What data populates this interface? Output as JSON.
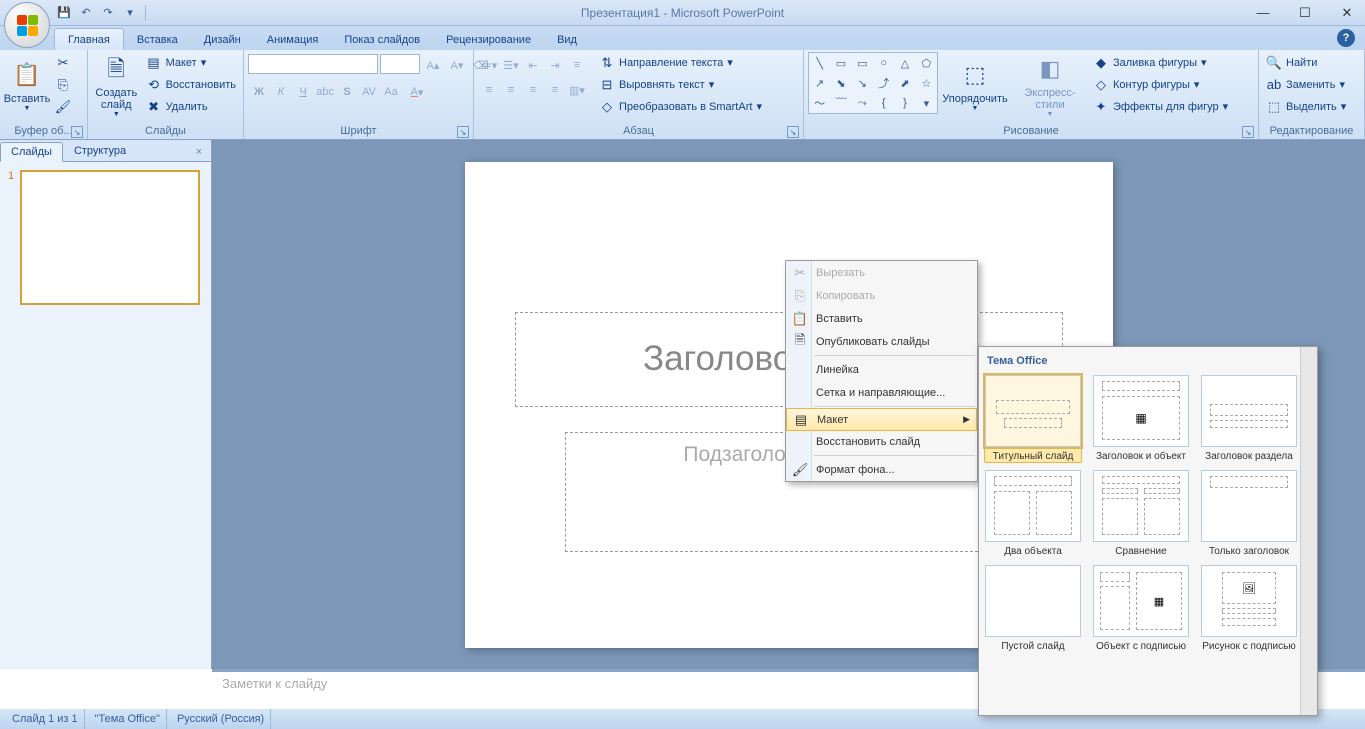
{
  "title": "Презентация1 - Microsoft PowerPoint",
  "tabs": {
    "home": "Главная",
    "insert": "Вставка",
    "design": "Дизайн",
    "animation": "Анимация",
    "slideshow": "Показ слайдов",
    "review": "Рецензирование",
    "view": "Вид"
  },
  "ribbon": {
    "clipboard": {
      "label": "Буфер об...",
      "paste": "Вставить"
    },
    "slides": {
      "label": "Слайды",
      "new": "Создать слайд",
      "layout": "Макет",
      "reset": "Восстановить",
      "delete": "Удалить"
    },
    "font": {
      "label": "Шрифт"
    },
    "paragraph": {
      "label": "Абзац",
      "textdir": "Направление текста",
      "align": "Выровнять текст",
      "smartart": "Преобразовать в SmartArt"
    },
    "drawing": {
      "label": "Рисование",
      "arrange": "Упорядочить",
      "quick": "Экспресс-стили",
      "fill": "Заливка фигуры",
      "outline": "Контур фигуры",
      "effects": "Эффекты для фигур"
    },
    "editing": {
      "label": "Редактирование",
      "find": "Найти",
      "replace": "Заменить",
      "select": "Выделить"
    }
  },
  "outline": {
    "slides": "Слайды",
    "structure": "Структура",
    "num": "1"
  },
  "slide": {
    "title": "Заголовок слайда",
    "subtitle": "Подзаголовок слайда"
  },
  "notes": "Заметки к слайду",
  "status": {
    "pos": "Слайд 1 из 1",
    "theme": "\"Тема Office\"",
    "lang": "Русский (Россия)"
  },
  "context": {
    "cut": "Вырезать",
    "copy": "Копировать",
    "paste": "Вставить",
    "publish": "Опубликовать слайды",
    "ruler": "Линейка",
    "grid": "Сетка и направляющие...",
    "layout": "Макет",
    "reset": "Восстановить слайд",
    "format": "Формат фона..."
  },
  "layouts": {
    "header": "Тема Office",
    "l1": "Титульный слайд",
    "l2": "Заголовок и объект",
    "l3": "Заголовок раздела",
    "l4": "Два объекта",
    "l5": "Сравнение",
    "l6": "Только заголовок",
    "l7": "Пустой слайд",
    "l8": "Объект с подписью",
    "l9": "Рисунок с подписью"
  }
}
